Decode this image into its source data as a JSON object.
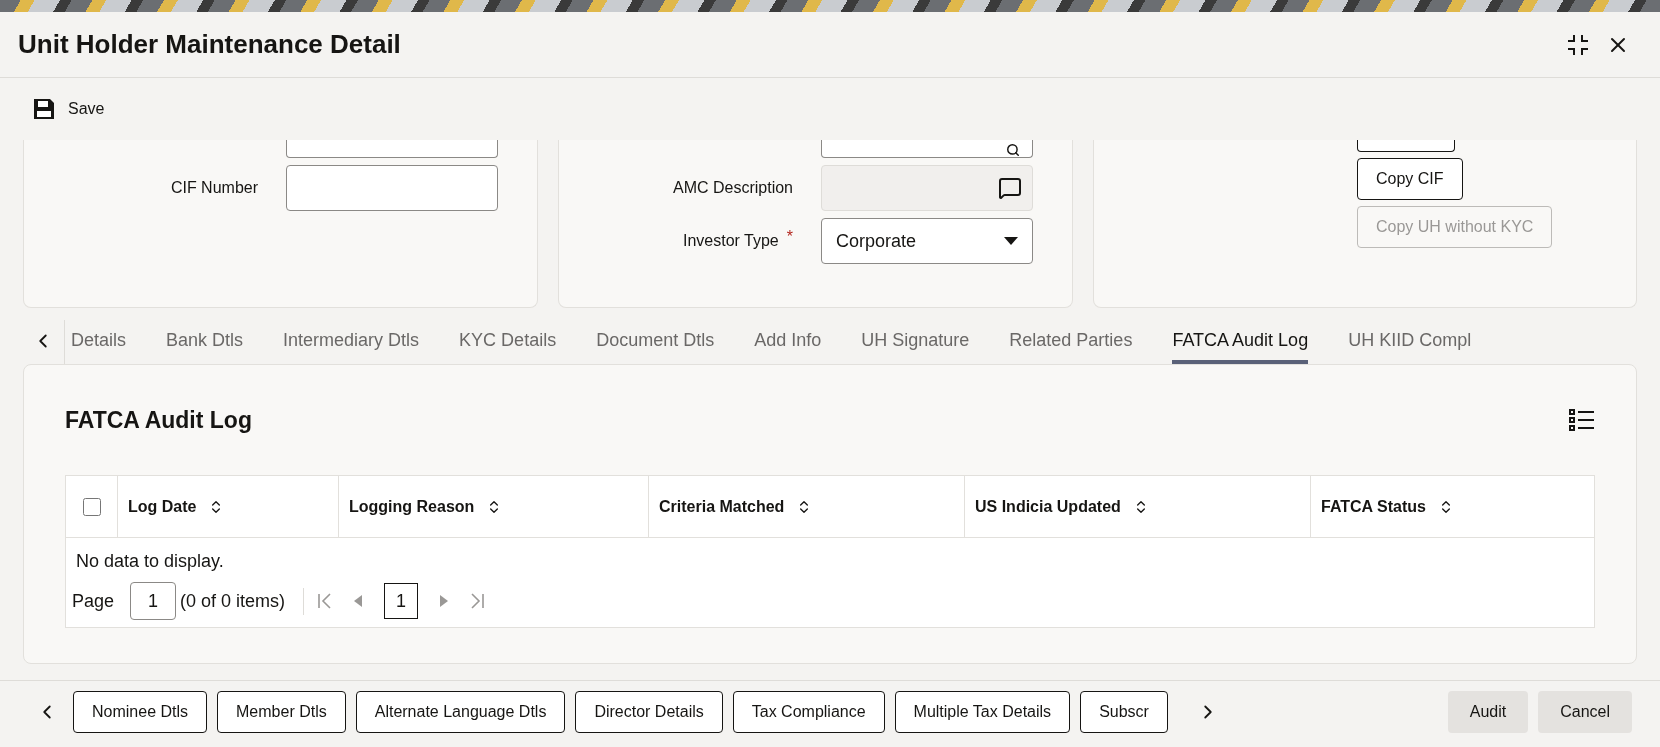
{
  "window": {
    "title": "Unit Holder Maintenance Detail"
  },
  "toolbar": [
    {
      "label": "Save"
    }
  ],
  "form": {
    "left_fields": [
      {
        "label": "CIF Number"
      }
    ],
    "middle_fields": [
      {
        "label": "AMC Description",
        "kind": "readonly"
      },
      {
        "label": "Investor Type",
        "kind": "select",
        "required_mark": "*",
        "value": "Corporate"
      }
    ],
    "buttons": [
      {
        "label": "Copy CIF",
        "disabled": false
      },
      {
        "label": "Copy UH without KYC",
        "disabled": true
      }
    ]
  },
  "tabs": [
    {
      "label": "Details",
      "selected": false
    },
    {
      "label": "Bank Dtls",
      "selected": false
    },
    {
      "label": "Intermediary Dtls",
      "selected": false
    },
    {
      "label": "KYC Details",
      "selected": false
    },
    {
      "label": "Document Dtls",
      "selected": false
    },
    {
      "label": "Add Info",
      "selected": false
    },
    {
      "label": "UH Signature",
      "selected": false
    },
    {
      "label": "Related Parties",
      "selected": false
    },
    {
      "label": "FATCA Audit Log",
      "selected": true
    },
    {
      "label": "UH KIID Compl",
      "selected": false
    }
  ],
  "section": {
    "title": "FATCA Audit Log",
    "table": {
      "select_all_checked": false,
      "columns": [
        "Log Date",
        "Logging Reason",
        "Criteria Matched",
        "US Indicia Updated",
        "FATCA Status"
      ],
      "empty_message": "No data to display."
    },
    "pagination": {
      "label": "Page",
      "page_input": "1",
      "summary": "(0 of 0 items)",
      "current_page": "1"
    }
  },
  "footer_tabs": [
    "Nominee Dtls",
    "Member Dtls",
    "Alternate Language Dtls",
    "Director Details",
    "Tax Compliance",
    "Multiple Tax Details",
    "Subscr"
  ],
  "actions": [
    "Audit",
    "Cancel"
  ]
}
